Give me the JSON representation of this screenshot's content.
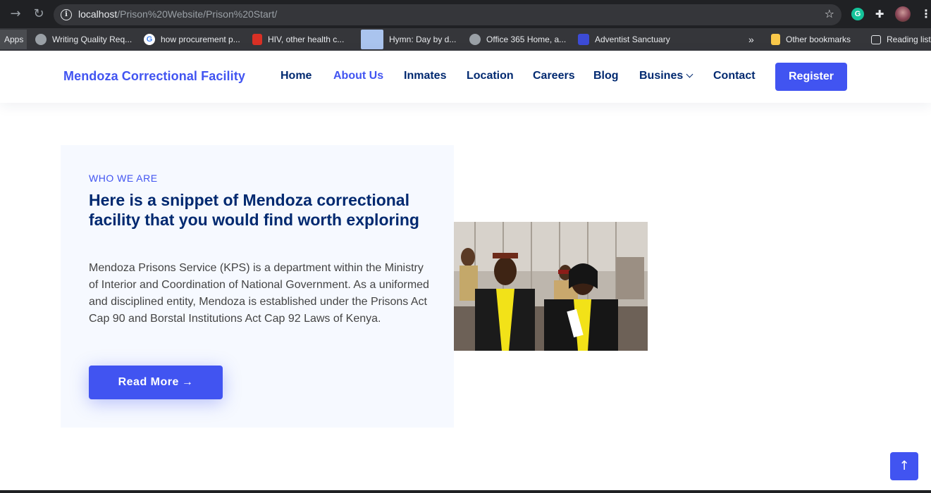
{
  "browser": {
    "url_host": "localhost",
    "url_path": "/Prison%20Website/Prison%20Start/",
    "bookmarks": [
      {
        "label": "Apps",
        "color": "#4a4c50"
      },
      {
        "label": "Writing Quality Req...",
        "color": "#9aa0a6"
      },
      {
        "label": "how procurement p...",
        "color": "#ffffff"
      },
      {
        "label": "HIV, other health c...",
        "color": "#d93025"
      },
      {
        "label": "Hymn: Day by d...",
        "color": "#aac4ee"
      },
      {
        "label": "Office 365 Home, a...",
        "color": "#9aa0a6"
      },
      {
        "label": "Adventist Sanctuary",
        "color": "#3c4bd6"
      }
    ],
    "overflow": "»",
    "other_bookmarks": "Other bookmarks",
    "reading_list": "Reading list"
  },
  "nav": {
    "brand": "Mendoza Correctional Facility",
    "links": [
      "Home",
      "About Us",
      "Inmates",
      "Location",
      "Careers",
      "Blog",
      "Busines",
      "Contact"
    ],
    "active": "About Us",
    "register": "Register"
  },
  "about": {
    "eyebrow": "WHO WE ARE",
    "headline": "Here is a snippet of Mendoza correctional facility that you would find worth exploring",
    "paragraph": "Mendoza Prisons Service (KPS) is a department within the Ministry of Interior and Coordination of National Government. As a uniformed and disciplined entity, Mendoza is established under the Prisons Act Cap 90 and Borstal Institutions Act Cap 92 Laws of Kenya.",
    "button": "Read More",
    "button_arrow": "→"
  },
  "scroll_top_icon": "↑",
  "colors": {
    "accent": "#4154f1",
    "navy": "#012970",
    "panel": "#f6f9ff"
  }
}
